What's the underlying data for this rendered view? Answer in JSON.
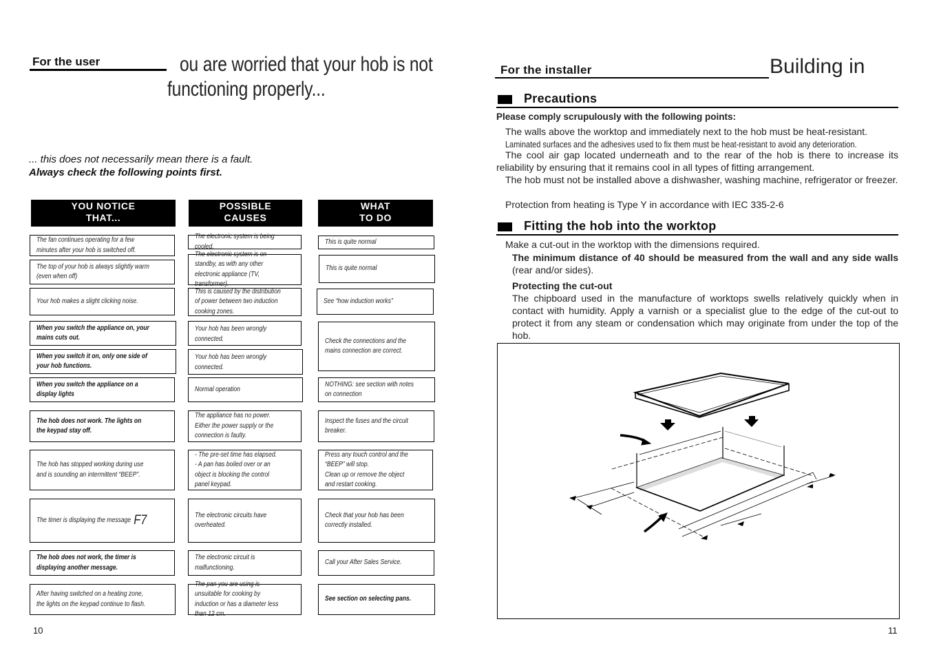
{
  "left_page": {
    "section_label": "For the user",
    "title_line1": "ou are worried that your hob is not",
    "title_line2": "functioning properly...",
    "intro_line1": "... this does not necessarily mean there is a fault.",
    "intro_line2": "Always check the following points first.",
    "columns": [
      {
        "line1": "YOU NOTICE",
        "line2": "THAT..."
      },
      {
        "line1": "POSSIBLE",
        "line2": "CAUSES"
      },
      {
        "line1": "WHAT",
        "line2": "TO DO"
      }
    ],
    "notice": [
      "The fan continues operating for a few minutes after your hob is switched off.",
      "The top of your hob is always slightly warm (even when off)",
      "Your hob makes a slight clicking noise.",
      "When you switch the appliance on, your mains cuts out.",
      "When you switch it on, only one side of your hob functions.",
      "When you switch the appliance on a display lights",
      "The hob does not work. The lights on the keypad stay off.",
      "The hob has stopped working during use and is sounding an intermittent “BEEP”.",
      "The timer is displaying the message",
      "The hob does not work, the timer is displaying another message.",
      "After having switched on a heating zone, the lights on the keypad continue to flash."
    ],
    "f7_code": "F7",
    "causes": [
      "The electronic system is being cooled.",
      "The electronic system is on standby, as with any other electronic appliance (TV, transformer).",
      "This is caused by the distribution of power between two induction cooking zones.",
      "Your hob has been wrongly connected.",
      "Your hob has been wrongly connected.",
      "Normal operation",
      "The appliance has no power. Either the power supply or the connection is faulty.",
      "- The pre-set time has elapsed.\n- A pan has boiled over or an object is blocking the control panel keypad.",
      "The electronic circuits have overheated.",
      "The electronic circuit is malfunctioning.",
      "The pan you are using is unsuitable for cooking by induction or has a diameter less than 12 cm."
    ],
    "actions": [
      "This is quite normal",
      "This is quite normal",
      "See “how induction works”",
      "Check the connections and the mains connection are correct.",
      "NOTHING: see section with notes on connection",
      "Inspect the fuses and the circuit breaker.",
      "Press any touch control and the “BEEP” will stop.\nClean up or remove the object and restart cooking.",
      "Check that your hob has been correctly installed.",
      "Call your After Sales Service.",
      "See section on selecting pans."
    ],
    "page_number": "10"
  },
  "right_page": {
    "section_label": "For the installer",
    "title": "Building in",
    "precautions": {
      "heading": "Precautions",
      "lead": "Please comply scrupulously with the following points:",
      "p1": "The walls above the worktop and immediately next to the hob must be  heat-resistant.",
      "p2": "Laminated surfaces and the adhesives used to fix them must be heat-resistant to avoid any deterioration.",
      "p3": "The cool air gap located underneath and to the rear of the hob is there to increase its reliability by ensuring that it remains cool in all types of fitting arrangement.",
      "p4": "The hob must not be installed above a dishwasher, washing machine, refrigerator or freezer.",
      "p5": "Protection from heating is Type Y in accordance with IEC 335-2-6"
    },
    "fitting": {
      "heading": "Fitting the hob into the worktop",
      "p1": "Make a cut-out in the worktop with the dimensions required.",
      "p2_bold": "The  minimum distance of 40 should be measured from the wall and any side walls",
      "p2_rest": " (rear and/or sides).",
      "sub_heading": "Protecting the cut-out",
      "p3": "The chipboard used in the manufacture of worktops swells relatively quickly when in contact with humidity. Apply a varnish or a specialist glue to the edge of the cut-out to protect it from any steam or condensation which may originate from under the top of the hob."
    },
    "diagram": {
      "icon": "hob-cutout-installation-diagram"
    },
    "page_number": "11"
  }
}
